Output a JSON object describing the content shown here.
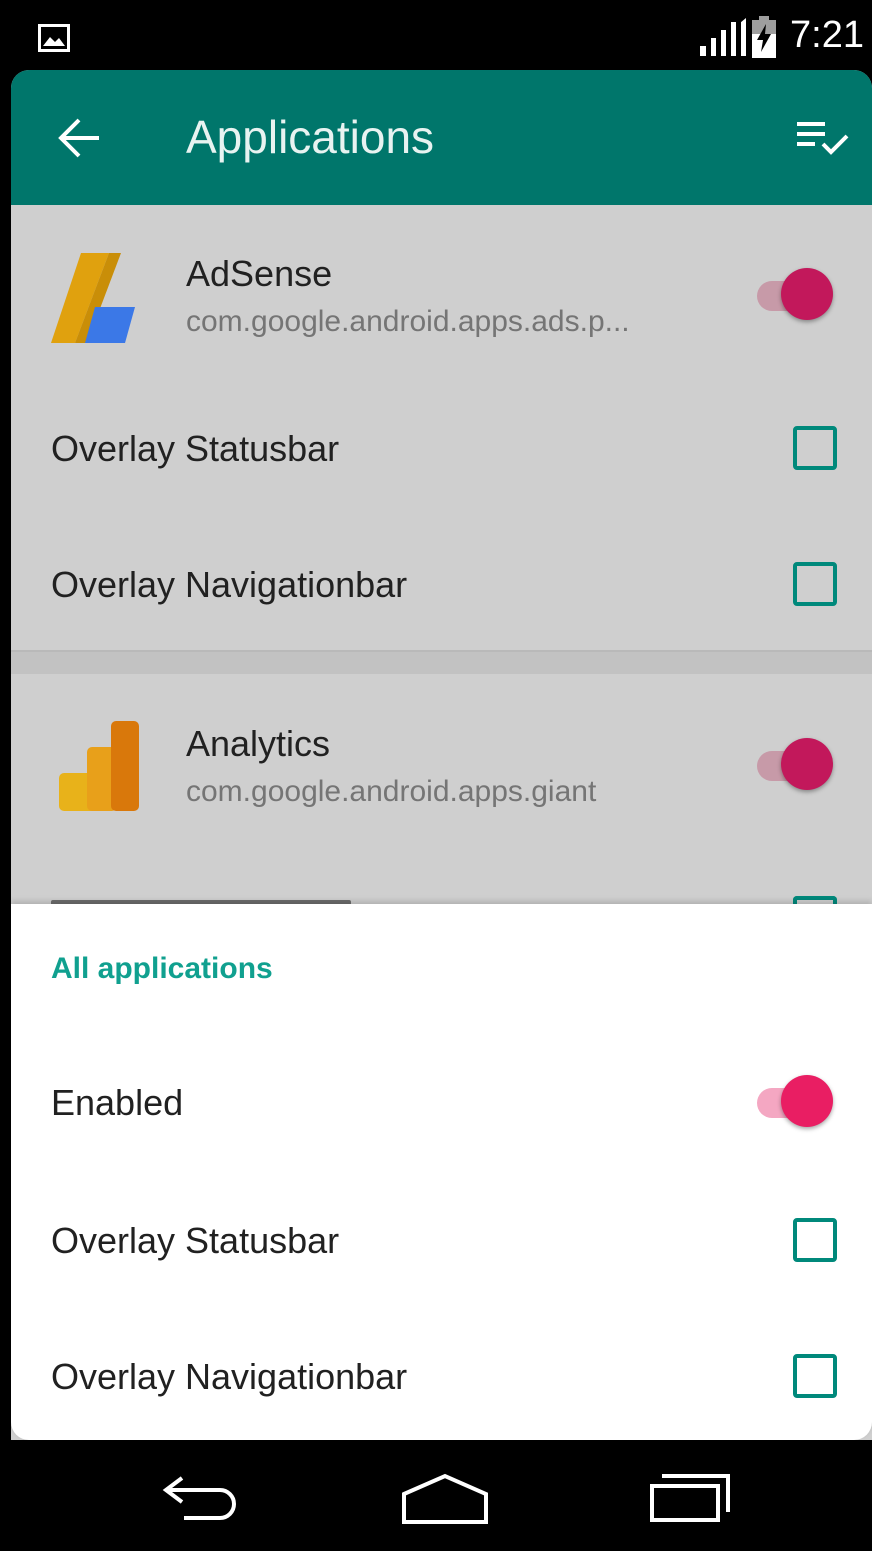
{
  "status_bar": {
    "time": "7:21",
    "icons": [
      "image-notification-icon",
      "signal-icon",
      "battery-charging-icon"
    ]
  },
  "toolbar": {
    "title": "Applications",
    "back_icon": "arrow-back-icon",
    "action_icon": "select-all-list-icon",
    "color": "#00766b"
  },
  "apps": [
    {
      "name": "AdSense",
      "package": "com.google.android.apps.ads.p...",
      "enabled": true,
      "icon": "adsense-logo-icon",
      "options": [
        {
          "label": "Overlay Statusbar",
          "checked": false
        },
        {
          "label": "Overlay Navigationbar",
          "checked": false
        }
      ]
    },
    {
      "name": "Analytics",
      "package": "com.google.android.apps.giant",
      "enabled": true,
      "icon": "analytics-logo-icon"
    }
  ],
  "sheet": {
    "header": "All applications",
    "enabled_label": "Enabled",
    "enabled": true,
    "options": [
      {
        "label": "Overlay Statusbar",
        "checked": false
      },
      {
        "label": "Overlay Navigationbar",
        "checked": false
      }
    ]
  },
  "nav_bar": {
    "icons": [
      "back-nav-icon",
      "home-nav-icon",
      "recents-nav-icon"
    ]
  },
  "colors": {
    "accent": "#e91e63",
    "accent_dimmed": "#c2185b",
    "checkbox": "#00897b",
    "section_header": "#10a08f"
  }
}
